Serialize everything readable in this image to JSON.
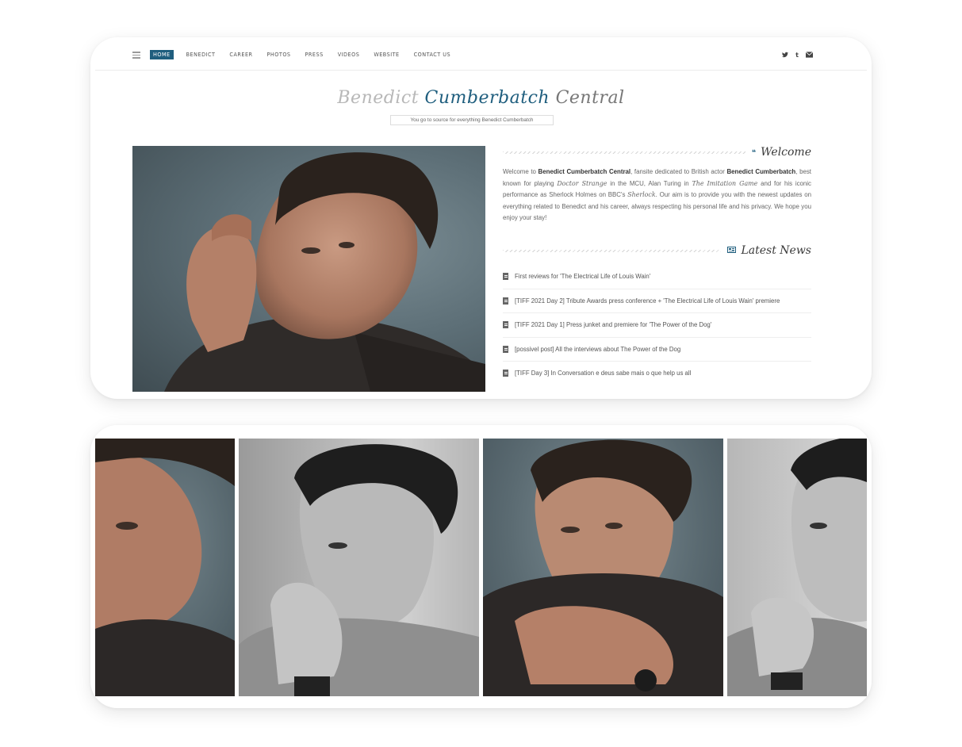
{
  "nav": {
    "items": [
      "HOME",
      "BENEDICT",
      "CAREER",
      "PHOTOS",
      "PRESS",
      "VIDEOS",
      "WEBSITE",
      "CONTACT US"
    ],
    "active": "HOME",
    "social_icons": [
      "twitter-icon",
      "tumblr-icon",
      "envelope-icon"
    ]
  },
  "header": {
    "title_part1": "Benedict",
    "title_part2": "Cumberbatch",
    "title_part3": "Central",
    "tagline": "You go to source for everything Benedict Cumberbatch"
  },
  "welcome": {
    "heading": "Welcome",
    "icon": "quote-icon",
    "p1": "Welcome to ",
    "b1": "Benedict Cumberbatch Central",
    "p2": ", fansite dedicated to British actor ",
    "b2": "Benedict Cumberbatch",
    "p3": ", best known for playing ",
    "i1": "Doctor Strange",
    "p4": " in the MCU, Alan Turing in ",
    "i2": "The Imitation Game",
    "p5": " and for his iconic performance as Sherlock Holmes on BBC's ",
    "i3": "Sherlock",
    "p6": ". Our aim is to provide you with the newest updates on everything related to Benedict and his career, always respecting his personal life and his privacy. We hope you enjoy your stay!"
  },
  "news": {
    "heading": "Latest News",
    "icon": "newspaper-icon",
    "items": [
      "First reviews for 'The Electrical Life of Louis Wain'",
      "[TIFF 2021 Day 2] Tribute Awards press conference + 'The Electrical Life of Louis Wain' premiere",
      "[TIFF 2021 Day 1] Press junket and premiere for 'The Power of the Dog'",
      "[possivel post] All the interviews about The Power of the Dog",
      "[TIFF Day 3] In Conversation e deus sabe mais o que help us all"
    ]
  },
  "colors": {
    "accent": "#1f5e7e",
    "text": "#555555",
    "card_bg": "#ffffff"
  }
}
